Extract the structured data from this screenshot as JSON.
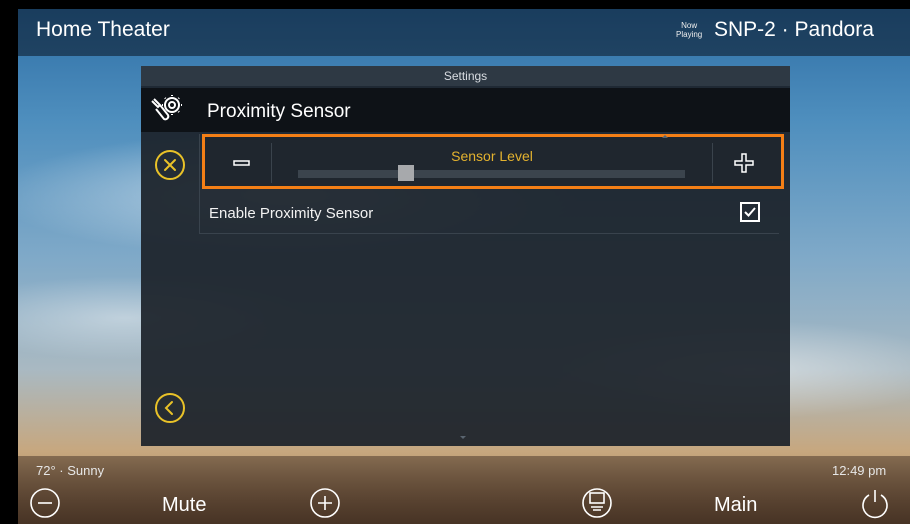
{
  "header": {
    "title": "Home Theater",
    "now_playing_line1": "Now",
    "now_playing_line2": "Playing",
    "source": "SNP-2 · Pandora"
  },
  "panel": {
    "header_title": "Settings",
    "subtitle": "Proximity Sensor",
    "subtitle_icon": "wrench-gear-icon",
    "close_icon": "close-circle-icon",
    "back_icon": "back-circle-icon"
  },
  "slider": {
    "label": "Sensor Level",
    "value": 0.28,
    "minus_icon": "minus-icon",
    "plus_icon": "plus-icon"
  },
  "options": [
    {
      "label": "Enable Proximity Sensor",
      "checked": true
    }
  ],
  "footer": {
    "weather": "72° · Sunny",
    "time": "12:49 pm",
    "mute_label": "Mute",
    "main_label": "Main",
    "icons": [
      "volume-down-icon",
      "volume-up-icon",
      "display-icon",
      "power-icon"
    ]
  },
  "colors": {
    "accent_yellow": "#e9c228",
    "highlight_orange": "#f47f16",
    "panel_bg": "#1c222a"
  }
}
